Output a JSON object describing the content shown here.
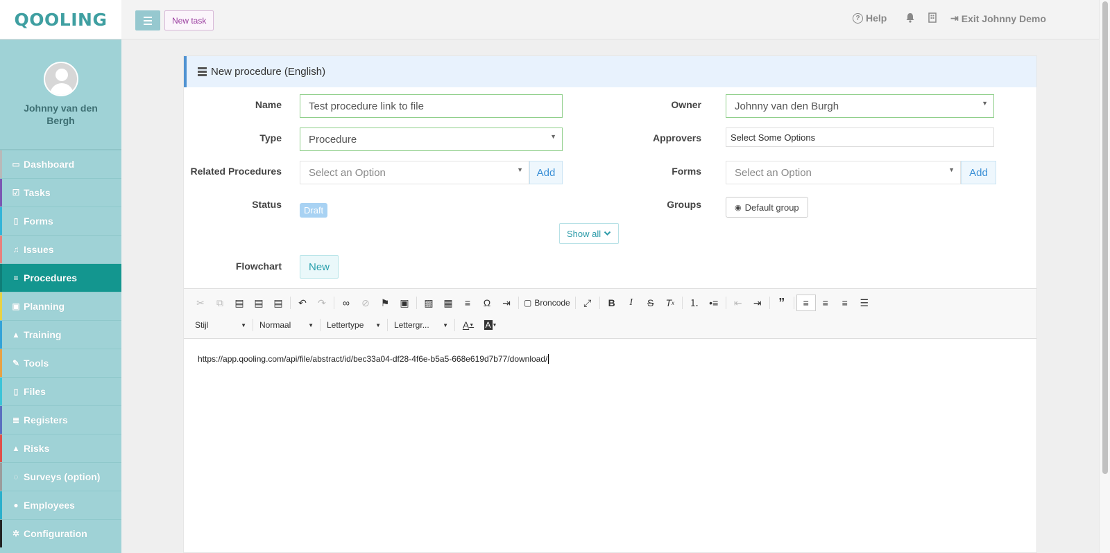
{
  "app": {
    "logo": "QOOLING"
  },
  "user": {
    "name": "Johnny van den Bergh"
  },
  "sidebar": {
    "items": [
      {
        "label": "Dashboard",
        "icon": "monitor-icon",
        "glyph": "▭",
        "color": "#b9b9b9",
        "active": false
      },
      {
        "label": "Tasks",
        "icon": "check-square-icon",
        "glyph": "☑",
        "color": "#7b57b3",
        "active": false
      },
      {
        "label": "Forms",
        "icon": "file-icon",
        "glyph": "▯",
        "color": "#33b4d8",
        "active": false
      },
      {
        "label": "Issues",
        "icon": "bell-icon",
        "glyph": "♫",
        "color": "#e9817e",
        "active": false
      },
      {
        "label": "Procedures",
        "icon": "procedures-icon",
        "glyph": "≡",
        "color": "#0f7e78",
        "active": true
      },
      {
        "label": "Planning",
        "icon": "calendar-icon",
        "glyph": "▣",
        "color": "#e8d244",
        "active": false
      },
      {
        "label": "Training",
        "icon": "graduation-cap-icon",
        "glyph": "▲",
        "color": "#33a3d8",
        "active": false
      },
      {
        "label": "Tools",
        "icon": "wrench-icon",
        "glyph": "✎",
        "color": "#e8a244",
        "active": false
      },
      {
        "label": "Files",
        "icon": "files-icon",
        "glyph": "▯",
        "color": "#3cc4d8",
        "active": false
      },
      {
        "label": "Registers",
        "icon": "list-icon",
        "glyph": "≣",
        "color": "#5a6fc0",
        "active": false
      },
      {
        "label": "Risks",
        "icon": "warning-icon",
        "glyph": "▲",
        "color": "#e0504a",
        "active": false
      },
      {
        "label": "Surveys (option)",
        "icon": "comment-icon",
        "glyph": "◌",
        "color": "#9b9b9b",
        "active": false
      },
      {
        "label": "Employees",
        "icon": "users-icon",
        "glyph": "●",
        "color": "#2ab0cc",
        "active": false
      },
      {
        "label": "Configuration",
        "icon": "gear-icon",
        "glyph": "✲",
        "color": "#222222",
        "active": false
      }
    ]
  },
  "topbar": {
    "new_task": "New task",
    "help": "Help",
    "exit": "Exit Johnny Demo"
  },
  "panel": {
    "title": "New procedure (English)",
    "name_label": "Name",
    "name_value": "Test procedure link to file",
    "type_label": "Type",
    "type_value": "Procedure",
    "related_label": "Related Procedures",
    "related_placeholder": "Select an Option",
    "add_label": "Add",
    "status_label": "Status",
    "status_value": "Draft",
    "owner_label": "Owner",
    "owner_value": "Johnny van den Burgh",
    "approvers_label": "Approvers",
    "approvers_placeholder": "Select Some Options",
    "forms_label": "Forms",
    "forms_placeholder": "Select an Option",
    "groups_label": "Groups",
    "groups_value": "Default group",
    "show_all": "Show all",
    "flowchart_label": "Flowchart",
    "flowchart_new": "New"
  },
  "editor": {
    "source_label": "Broncode",
    "style_combo": "Stijl",
    "format_combo": "Normaal",
    "font_combo": "Lettertype",
    "size_combo": "Lettergr...",
    "content": "https://app.qooling.com/api/file/abstract/id/bec33a04-df28-4f6e-b5a5-668e619d7b77/download/"
  }
}
